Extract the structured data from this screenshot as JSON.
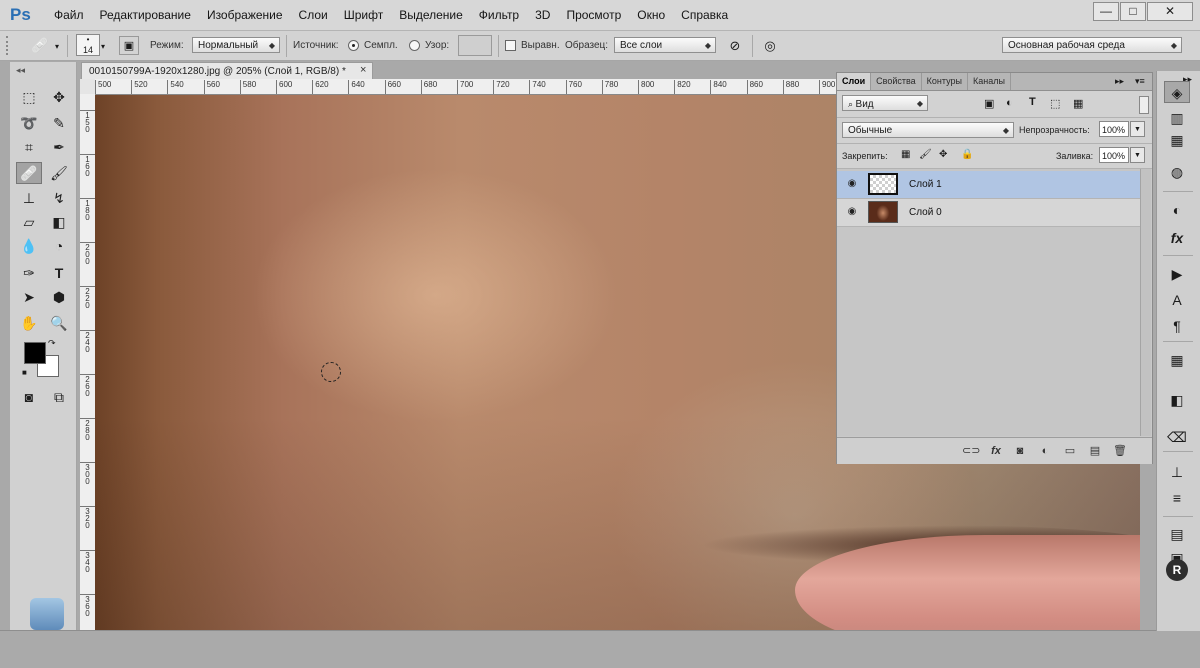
{
  "app": {
    "logo": "Ps",
    "menu": [
      "Файл",
      "Редактирование",
      "Изображение",
      "Слои",
      "Шрифт",
      "Выделение",
      "Фильтр",
      "3D",
      "Просмотр",
      "Окно",
      "Справка"
    ],
    "window_controls": {
      "minimize": "—",
      "restore": "□",
      "close": "✕"
    }
  },
  "options_bar": {
    "brush_size": "14",
    "mode_label": "Режим:",
    "mode_value": "Нормальный",
    "source_label": "Источник:",
    "source_sampled_label": "Семпл.",
    "source_pattern_label": "Узор:",
    "aligned_label": "Выравн.",
    "sample_label": "Образец:",
    "sample_value": "Все слои",
    "workspace_value": "Основная рабочая среда"
  },
  "document": {
    "tab_title": "0010150799A-1920x1280.jpg @ 205% (Слой 1, RGB/8) *",
    "close": "×",
    "ruler_top": [
      "500",
      "520",
      "540",
      "560",
      "580",
      "600",
      "620",
      "640",
      "660",
      "680",
      "700",
      "720",
      "740",
      "760",
      "780",
      "800",
      "820",
      "840",
      "860",
      "880",
      "900"
    ],
    "ruler_left": [
      [
        "1",
        "5",
        "0"
      ],
      [
        "1",
        "6",
        "0"
      ],
      [
        "1",
        "8",
        "0"
      ],
      [
        "2",
        "0",
        "0"
      ],
      [
        "2",
        "2",
        "0"
      ],
      [
        "2",
        "4",
        "0"
      ],
      [
        "2",
        "6",
        "0"
      ],
      [
        "2",
        "8",
        "0"
      ],
      [
        "3",
        "0",
        "0"
      ],
      [
        "3",
        "2",
        "0"
      ],
      [
        "3",
        "4",
        "0"
      ],
      [
        "3",
        "6",
        "0"
      ]
    ]
  },
  "toolbox": {
    "tools": [
      "marquee",
      "move",
      "lasso",
      "quick-select",
      "crop",
      "eyedropper",
      "spot-healing",
      "brush",
      "clone-stamp",
      "history-brush",
      "eraser",
      "gradient",
      "blur",
      "dodge",
      "pen",
      "type",
      "path-select",
      "shape",
      "hand",
      "zoom"
    ],
    "active_tool": "spot-healing",
    "foreground_color": "#000000",
    "background_color": "#ffffff"
  },
  "layers_panel": {
    "tabs": [
      "Слои",
      "Свойства",
      "Контуры",
      "Каналы"
    ],
    "active_tab": "Слои",
    "filter_label": "Вид",
    "blend_mode": "Обычные",
    "opacity_label": "Непрозрачность:",
    "opacity_value": "100%",
    "lock_label": "Закрепить:",
    "fill_label": "Заливка:",
    "fill_value": "100%",
    "layers": [
      {
        "name": "Слой 1",
        "selected": true,
        "thumbnail": "transparent"
      },
      {
        "name": "Слой 0",
        "selected": false,
        "thumbnail": "photo"
      }
    ],
    "footer_icons": [
      "link-icon",
      "fx-icon",
      "mask-icon",
      "adjustment-icon",
      "group-icon",
      "new-layer-icon",
      "trash-icon"
    ],
    "footer_fx": "fx"
  },
  "colors": {
    "accent_logo": "#2a6fb4",
    "selected_layer": "#b0c5e3",
    "ui_gray": "#d3d3d3"
  },
  "right_dock": {
    "icons": [
      "layers-icon",
      "adjust-icon",
      "styles-icon",
      "color-icon",
      "histogram-icon",
      "fx-icon",
      "actions-icon",
      "character-icon",
      "paragraph-icon",
      "swatches-icon",
      "navigator-icon",
      "tool-presets-icon",
      "brush-icon",
      "clone-source-icon",
      "notes-icon",
      "info-icon",
      "r-icon"
    ],
    "dock_A": "A",
    "dock_para": "¶",
    "dock_R": "R",
    "dock_fx": "fx"
  }
}
